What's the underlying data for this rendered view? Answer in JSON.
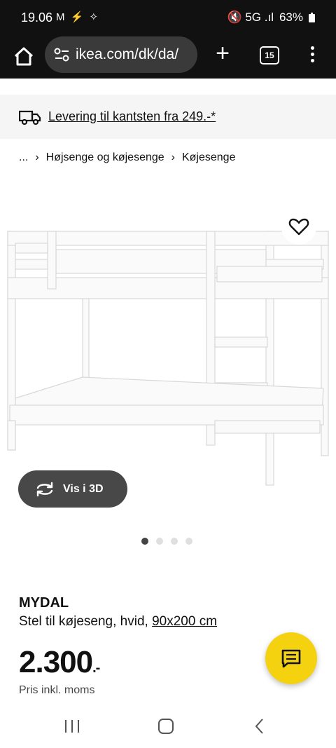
{
  "status": {
    "time": "19.06",
    "icons": "M ⚡ ✧",
    "right_icons": "🔇 5G .ıl",
    "battery": "63%"
  },
  "browser": {
    "url": "ikea.com/dk/da/",
    "tab_count": "15"
  },
  "delivery": {
    "text": "Levering til kantsten fra 249.-*"
  },
  "breadcrumb": {
    "ellipsis": "...",
    "sep": "›",
    "items": [
      "Højsenge og køjesenge",
      "Køjesenge"
    ]
  },
  "view3d": {
    "label": "Vis i 3D"
  },
  "carousel": {
    "count": 4,
    "active": 0
  },
  "product": {
    "name": "MYDAL",
    "desc_prefix": "Stel til køjeseng, hvid,",
    "dimensions": "90x200 cm",
    "price_main": "2.300",
    "price_suffix": ".-",
    "tax_note": "Pris inkl. moms"
  },
  "colors": {
    "accent": "#f5d20f",
    "dark": "#111111",
    "button_3d": "#484848"
  }
}
